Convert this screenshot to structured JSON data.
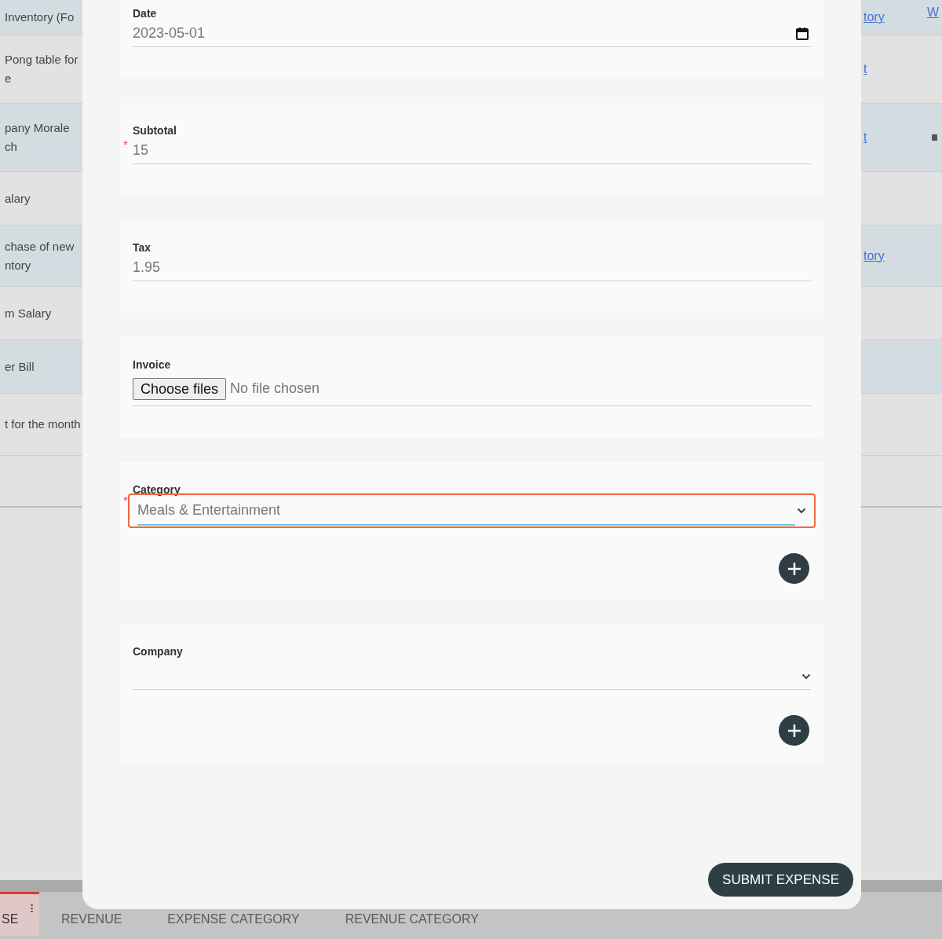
{
  "background_table": {
    "rows": [
      {
        "left": [
          "Inventory (Fo"
        ],
        "right": "tory",
        "shaded": true
      },
      {
        "left": [
          "Pong table for",
          "e"
        ],
        "right": "t",
        "shaded": false
      },
      {
        "left": [
          "pany Morale",
          "ch"
        ],
        "right": "t",
        "shaded": true
      },
      {
        "left": [
          "alary"
        ],
        "shaded": false
      },
      {
        "left": [
          "chase of new",
          "ntory"
        ],
        "right": "tory",
        "shaded": true
      },
      {
        "left": [
          "m Salary"
        ],
        "shaded": false
      },
      {
        "left": [
          "er Bill"
        ],
        "shaded": true
      },
      {
        "left": [
          "t for the month"
        ],
        "shaded": false
      }
    ],
    "corner_link": "W"
  },
  "tabs": [
    {
      "label": "SE",
      "selected": true
    },
    {
      "label": "REVENUE",
      "selected": false
    },
    {
      "label": "EXPENSE CATEGORY",
      "selected": false
    },
    {
      "label": "REVENUE CATEGORY",
      "selected": false
    }
  ],
  "form": {
    "fields": [
      {
        "kind": "date",
        "label": "Date",
        "value": "2023-05-01",
        "highlighted": false,
        "add_button": false
      },
      {
        "kind": "text",
        "label": "Subtotal",
        "value": "15",
        "required_mark": "*",
        "highlighted": false,
        "add_button": false
      },
      {
        "kind": "text",
        "label": "Tax",
        "value": "1.95",
        "highlighted": false,
        "add_button": false
      },
      {
        "kind": "file",
        "label": "Invoice",
        "button": "Choose files",
        "value": "No file chosen",
        "add_button": false
      },
      {
        "kind": "select",
        "label": "Category",
        "value": "Meals & Entertainment",
        "required_mark": "*",
        "highlighted": true,
        "add_button": true
      },
      {
        "kind": "select",
        "label": "Company",
        "highlighted": false,
        "add_button": true
      }
    ],
    "submit": "SUBMIT EXPENSE"
  }
}
